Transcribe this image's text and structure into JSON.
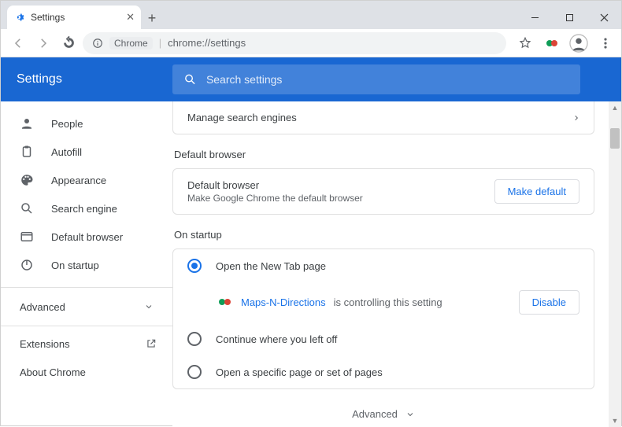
{
  "window": {
    "tab_title": "Settings",
    "omnibox_chip": "Chrome",
    "omnibox_url": "chrome://settings"
  },
  "header": {
    "title": "Settings",
    "search_placeholder": "Search settings"
  },
  "sidebar": {
    "items": [
      {
        "label": "People"
      },
      {
        "label": "Autofill"
      },
      {
        "label": "Appearance"
      },
      {
        "label": "Search engine"
      },
      {
        "label": "Default browser"
      },
      {
        "label": "On startup"
      }
    ],
    "advanced": "Advanced",
    "extensions": "Extensions",
    "about": "About Chrome"
  },
  "content": {
    "manage_search": "Manage search engines",
    "default_browser_heading": "Default browser",
    "default_browser_title": "Default browser",
    "default_browser_sub": "Make Google Chrome the default browser",
    "make_default_btn": "Make default",
    "startup_heading": "On startup",
    "radio_new_tab": "Open the New Tab page",
    "controller_link": "Maps-N-Directions",
    "controller_rest": "is controlling this setting",
    "disable_btn": "Disable",
    "radio_continue": "Continue where you left off",
    "radio_specific": "Open a specific page or set of pages",
    "advanced_footer": "Advanced"
  }
}
